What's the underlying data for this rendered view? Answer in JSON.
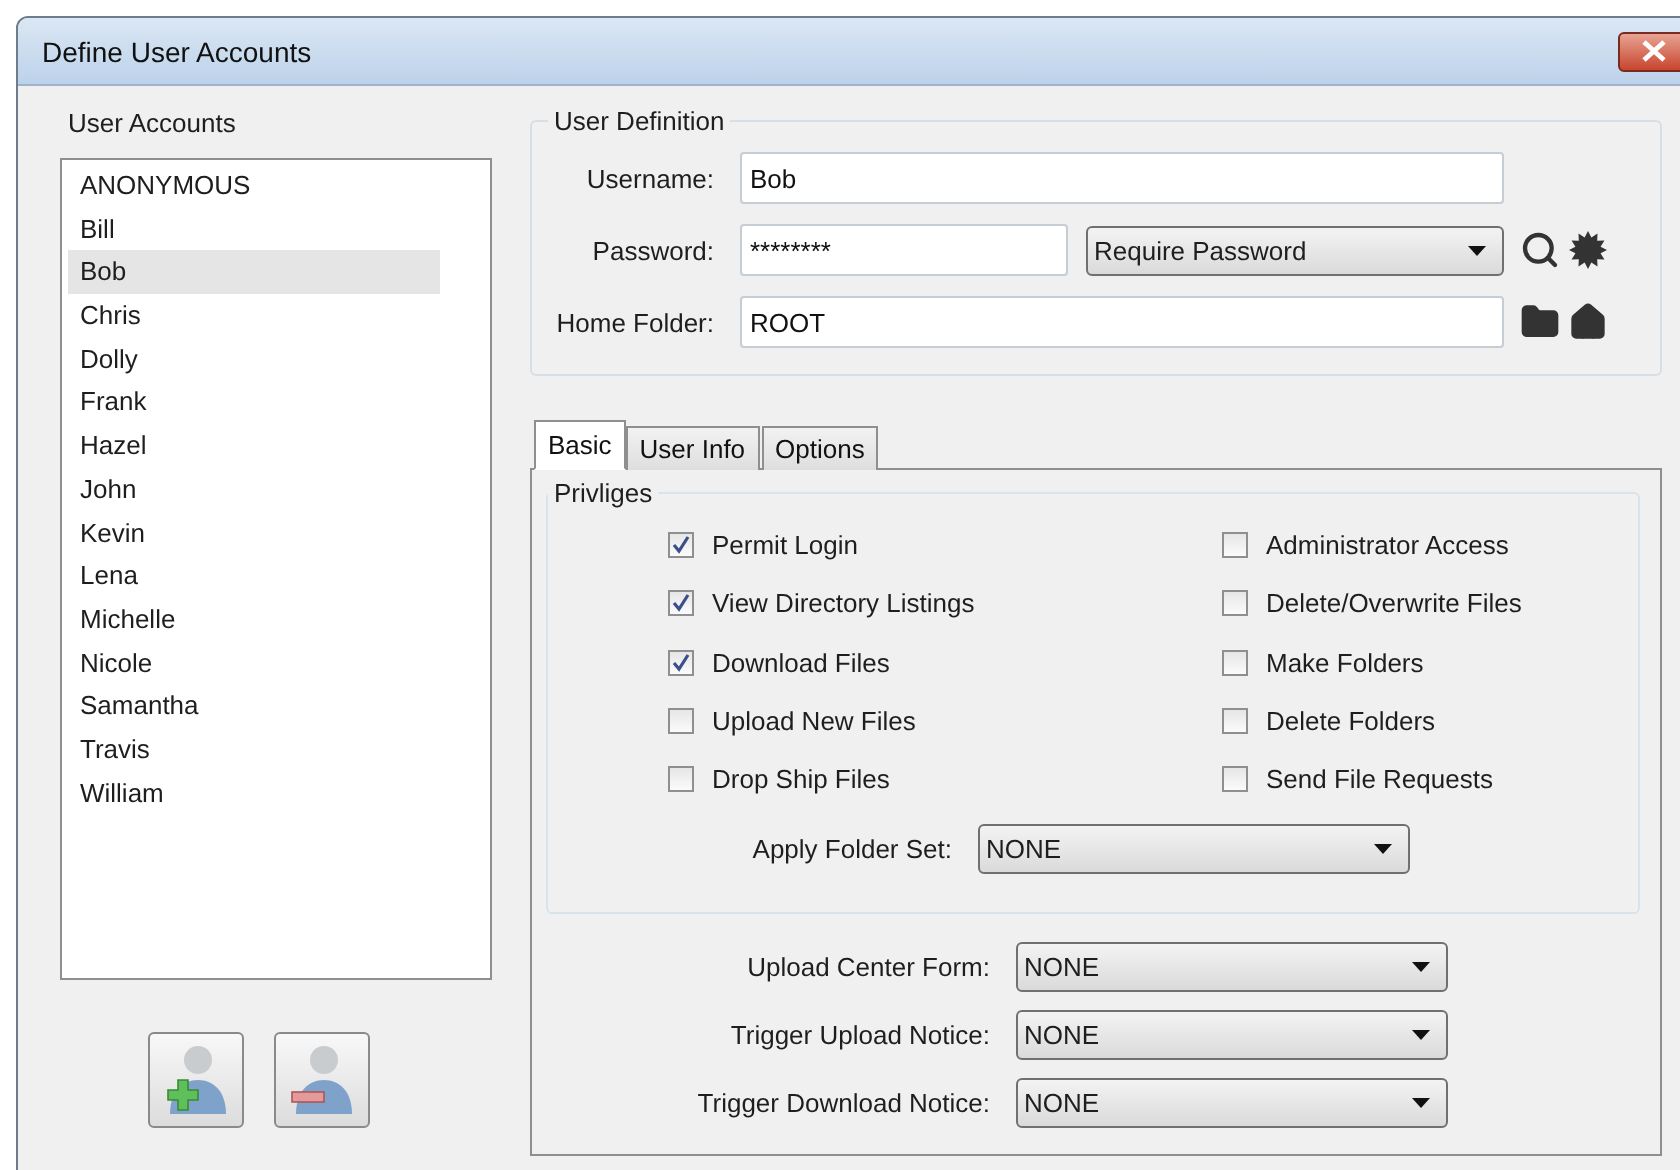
{
  "window": {
    "title": "Define User Accounts"
  },
  "accounts": {
    "label": "User Accounts",
    "items": [
      {
        "name": "ANONYMOUS",
        "selected": false
      },
      {
        "name": "Bill",
        "selected": false
      },
      {
        "name": "Bob",
        "selected": true
      },
      {
        "name": "Chris",
        "selected": false
      },
      {
        "name": "Dolly",
        "selected": false
      },
      {
        "name": "Frank",
        "selected": false
      },
      {
        "name": "Hazel",
        "selected": false
      },
      {
        "name": "John",
        "selected": false
      },
      {
        "name": "Kevin",
        "selected": false
      },
      {
        "name": "Lena",
        "selected": false
      },
      {
        "name": "Michelle",
        "selected": false
      },
      {
        "name": "Nicole",
        "selected": false
      },
      {
        "name": "Samantha",
        "selected": false
      },
      {
        "name": "Travis",
        "selected": false
      },
      {
        "name": "William",
        "selected": false
      }
    ]
  },
  "user_definition": {
    "legend": "User Definition",
    "username": {
      "label": "Username:",
      "value": "Bob"
    },
    "password": {
      "label": "Password:",
      "value": "********",
      "mode": "Require Password"
    },
    "home_folder": {
      "label": "Home Folder:",
      "value": "ROOT"
    }
  },
  "tabs": [
    {
      "label": "Basic",
      "selected": true
    },
    {
      "label": "User Info",
      "selected": false
    },
    {
      "label": "Options",
      "selected": false
    }
  ],
  "privileges": {
    "legend": "Privliges",
    "items": [
      {
        "label": "Permit Login",
        "checked": true
      },
      {
        "label": "View Directory Listings",
        "checked": true
      },
      {
        "label": "Download Files",
        "checked": true
      },
      {
        "label": "Upload New Files",
        "checked": false
      },
      {
        "label": "Drop Ship Files",
        "checked": false
      },
      {
        "label": "Administrator Access",
        "checked": false
      },
      {
        "label": "Delete/Overwrite Files",
        "checked": false
      },
      {
        "label": "Make Folders",
        "checked": false
      },
      {
        "label": "Delete Folders",
        "checked": false
      },
      {
        "label": "Send File Requests",
        "checked": false
      }
    ]
  },
  "folder_set": {
    "label": "Apply Folder Set:",
    "value": "NONE"
  },
  "notices": [
    {
      "label": "Upload Center Form:",
      "value": "NONE"
    },
    {
      "label": "Trigger Upload Notice:",
      "value": "NONE"
    },
    {
      "label": "Trigger Download Notice:",
      "value": "NONE"
    }
  ]
}
